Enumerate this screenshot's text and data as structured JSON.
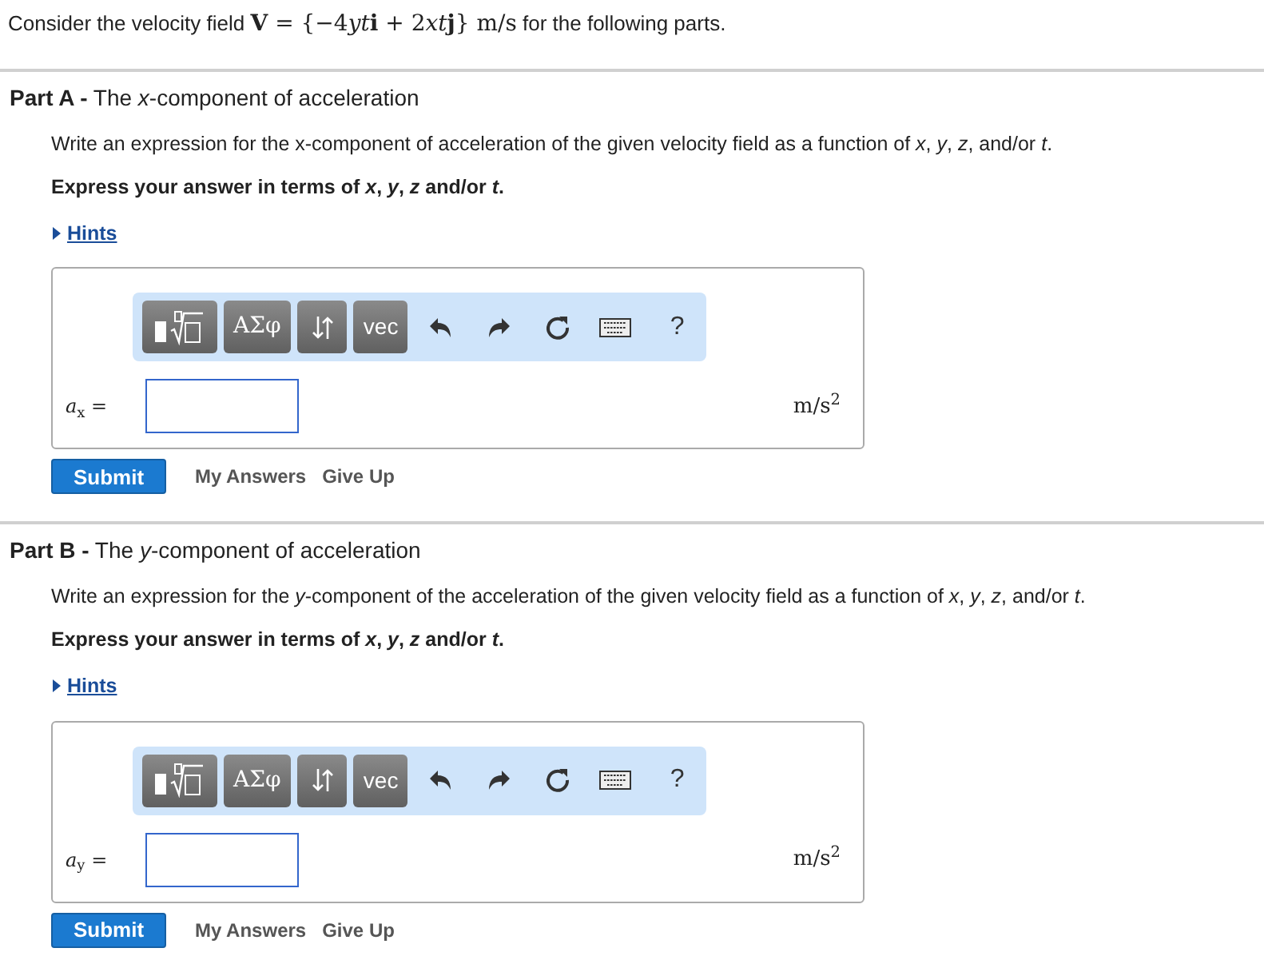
{
  "intro": [
    {
      "kind": "plain",
      "text": "Consider the velocity field "
    },
    {
      "kind": "math_bold",
      "text": "V"
    },
    {
      "kind": "math",
      "text": " = {−4"
    },
    {
      "kind": "math_italic",
      "text": "yt"
    },
    {
      "kind": "math_bold",
      "text": "i"
    },
    {
      "kind": "math",
      "text": " + 2"
    },
    {
      "kind": "math_italic",
      "text": "xt"
    },
    {
      "kind": "math_bold",
      "text": "j"
    },
    {
      "kind": "math",
      "text": "} m/s"
    },
    {
      "kind": "plain",
      "text": " for the following parts."
    }
  ],
  "parts": [
    {
      "label": "Part A -",
      "title": "The *x*-component of acceleration",
      "instruction": "Write an expression for the x-component of acceleration of the given velocity field as a function of *x*, *y*, *z*, and/or *t*.",
      "express": "Express your answer in terms of *x*, *y*, *z* and/or *t*.",
      "hints": "Hints",
      "toolbar": [
        {
          "kind": "templates"
        },
        {
          "kind": "text",
          "label": "ΑΣφ"
        },
        {
          "kind": "arrows"
        },
        {
          "kind": "sans_text",
          "label": "vec"
        },
        {
          "kind": "undo"
        },
        {
          "kind": "redo"
        },
        {
          "kind": "reset"
        },
        {
          "kind": "keyboard"
        },
        {
          "kind": "help",
          "label": "?"
        }
      ],
      "answer_label": "*a*$_{x}$ =",
      "units": "m/s$^{2}$",
      "buttons": [
        "Submit",
        "My Answers",
        "Give Up"
      ]
    },
    {
      "label": "Part B -",
      "title": "The *y*-component of acceleration",
      "instruction": "Write an expression for the *y*-component of the acceleration of the given velocity field as a function of *x*, *y*, *z*, and/or *t*.",
      "express": "Express your answer in terms of *x*, *y*, *z* and/or *t*.",
      "hints": "Hints",
      "toolbar": [
        {
          "kind": "templates"
        },
        {
          "kind": "text",
          "label": "ΑΣφ"
        },
        {
          "kind": "arrows"
        },
        {
          "kind": "sans_text",
          "label": "vec"
        },
        {
          "kind": "undo"
        },
        {
          "kind": "redo"
        },
        {
          "kind": "reset"
        },
        {
          "kind": "keyboard"
        },
        {
          "kind": "help",
          "label": "?"
        }
      ],
      "answer_label": "*a*$_{y}$ =",
      "units": "m/s$^{2}$",
      "buttons": [
        "Submit",
        "My Answers",
        "Give Up"
      ]
    }
  ]
}
